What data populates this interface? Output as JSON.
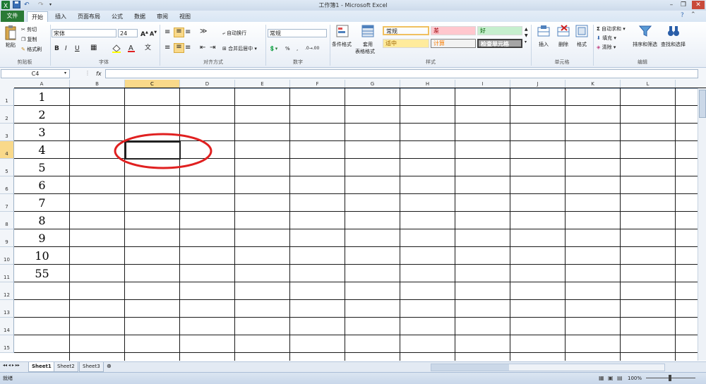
{
  "window": {
    "title": "工作簿1 - Microsoft Excel"
  },
  "tabs": [
    {
      "label": "文件"
    },
    {
      "label": "开始"
    },
    {
      "label": "插入"
    },
    {
      "label": "页面布局"
    },
    {
      "label": "公式"
    },
    {
      "label": "数据"
    },
    {
      "label": "审阅"
    },
    {
      "label": "视图"
    }
  ],
  "ribbon": {
    "clipboard": {
      "paste": "粘贴",
      "cut": "剪切",
      "copy": "复制",
      "format_painter": "格式刷",
      "group": "剪贴板"
    },
    "font": {
      "name": "宋体",
      "size": "24",
      "group": "字体",
      "bold": "B",
      "italic": "I",
      "underline": "U"
    },
    "align": {
      "wrap": "自动换行",
      "merge": "合并后居中",
      "group": "对齐方式"
    },
    "number": {
      "format": "常规",
      "percent": "%",
      "comma": ",",
      "group": "数字"
    },
    "styles": {
      "conditional": "条件格式",
      "table": "套用",
      "table2": "表格格式",
      "cells": [
        {
          "label": "常规",
          "bg": "#ffffff",
          "fg": "#000000"
        },
        {
          "label": "差",
          "bg": "#ffc7ce",
          "fg": "#9c0006"
        },
        {
          "label": "好",
          "bg": "#c6efce",
          "fg": "#006100"
        },
        {
          "label": "适中",
          "bg": "#ffeb9c",
          "fg": "#9c6500"
        },
        {
          "label": "计算",
          "bg": "#f2f2f2",
          "fg": "#fa7d00"
        },
        {
          "label": "检查单元格",
          "bg": "#a5a5a5",
          "fg": "#ffffff"
        }
      ],
      "group": "样式"
    },
    "cells_group": {
      "insert": "插入",
      "delete": "删除",
      "format": "格式",
      "group": "单元格"
    },
    "editing": {
      "autosum": "自动求和",
      "fill": "填充",
      "clear": "清除",
      "sort": "排序和筛选",
      "find": "查找和选择",
      "group": "编辑"
    }
  },
  "formula_bar": {
    "name_box": "C4",
    "fx": "fx",
    "content": ""
  },
  "columns": [
    "A",
    "B",
    "C",
    "D",
    "E",
    "F",
    "G",
    "H",
    "I",
    "J",
    "K",
    "L"
  ],
  "rows": [
    "1",
    "2",
    "3",
    "4",
    "5",
    "6",
    "7",
    "8",
    "9",
    "10",
    "11",
    "12",
    "13",
    "14",
    "15"
  ],
  "column_a_values": [
    "1",
    "2",
    "3",
    "4",
    "5",
    "6",
    "7",
    "8",
    "9",
    "10",
    "55"
  ],
  "selected_cell": "C4",
  "sheets": [
    "Sheet1",
    "Sheet2",
    "Sheet3"
  ],
  "status": {
    "text": "就绪",
    "zoom": "100%"
  },
  "annotation_color": "#e02020"
}
